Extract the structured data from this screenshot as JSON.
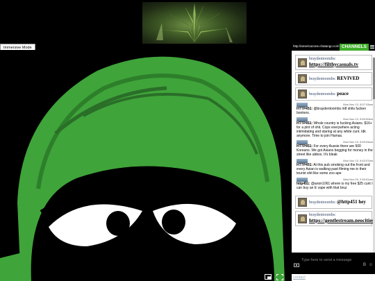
{
  "banner": {
    "alt": "cannabis-leaf-banner"
  },
  "immersive": {
    "label": "Immersive Mode"
  },
  "stage": {
    "image": "marvin-martian-face",
    "controls": [
      "picture-in-picture-icon",
      "fullscreen-icon"
    ]
  },
  "chat": {
    "url": "http://americazone.chatango.com",
    "channels_label": "CHANNELS",
    "messages_top": [
      {
        "user": "braydentoombs:",
        "text": "https://filthycasuals.tv",
        "link": true
      },
      {
        "user": "braydentoombs:",
        "text": "REVIVED",
        "link": false
      },
      {
        "user": "braydentoombs:",
        "text": "peace",
        "link": false
      }
    ],
    "messages_small": [
      {
        "time": "Mon Nov 13, 5:57:33am",
        "user": "HTTP451:",
        "text": "@braydentoombs m8 shits fucken bonkers."
      },
      {
        "time": "Mon Nov 13, 5:59:00am",
        "user": "HTTP451:",
        "text": "Whole country is fucking Asians. $16+ for a pint of shit. Cops everywhere acting intimidating and staring at any white cunt. Idk anymore. Time to join Hamas."
      },
      {
        "time": "Mon Nov 13, 5:59:53am",
        "user": "HTTP451:",
        "text": "For every Aussie there are 500 Koreans. We got Asians begging for money in the street like abbos. It's bleak"
      },
      {
        "time": "Mon Nov 13, 5:43:37am",
        "user": "HTTP451:",
        "text": "At this pub smoking out the front and every Asian is walking past filming me in their tourist shit like some zoo ape"
      },
      {
        "time": "Wed Nov 29, 2:59:51am",
        "user": "http451:",
        "text": "@anon1061 where is my free $25 cunt I can buy an E vape with that bruz"
      }
    ],
    "messages_bottom": [
      {
        "user": "braydentoombs:",
        "text": "@http451 hey",
        "link": false
      },
      {
        "user": "braydentoombs:",
        "text": "https://gentlestream.neocities.org/",
        "link": true
      }
    ],
    "input_placeholder": "Type here to send a message",
    "footer": {
      "contact": "contact",
      "count": "1",
      "set_name": "Set name"
    }
  }
}
